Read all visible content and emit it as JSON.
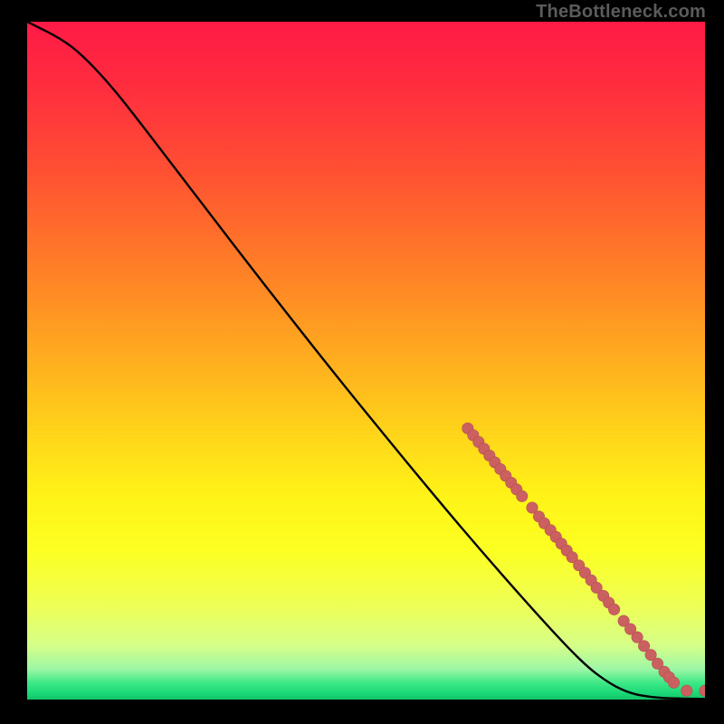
{
  "watermark": "TheBottleneck.com",
  "colors": {
    "gradient_stops": [
      {
        "offset": 0.0,
        "color": "#ff1a46"
      },
      {
        "offset": 0.1,
        "color": "#ff2e3e"
      },
      {
        "offset": 0.2,
        "color": "#ff4a34"
      },
      {
        "offset": 0.3,
        "color": "#ff6a2c"
      },
      {
        "offset": 0.4,
        "color": "#ff8b24"
      },
      {
        "offset": 0.5,
        "color": "#ffae1f"
      },
      {
        "offset": 0.6,
        "color": "#ffd21a"
      },
      {
        "offset": 0.7,
        "color": "#fff318"
      },
      {
        "offset": 0.78,
        "color": "#fcff22"
      },
      {
        "offset": 0.86,
        "color": "#eeff55"
      },
      {
        "offset": 0.92,
        "color": "#d6ff88"
      },
      {
        "offset": 0.955,
        "color": "#9df7a6"
      },
      {
        "offset": 0.975,
        "color": "#3fe887"
      },
      {
        "offset": 0.99,
        "color": "#1bd978"
      },
      {
        "offset": 1.0,
        "color": "#13c466"
      }
    ],
    "curve": "#000000",
    "marker_fill": "#cb6060",
    "marker_stroke": "#b45050"
  },
  "chart_data": {
    "type": "line",
    "title": "",
    "xlabel": "",
    "ylabel": "",
    "xlim": [
      0,
      100
    ],
    "ylim": [
      0,
      100
    ],
    "grid": false,
    "curve": [
      {
        "x": 0,
        "y": 100
      },
      {
        "x": 5,
        "y": 97.5
      },
      {
        "x": 8,
        "y": 95.2
      },
      {
        "x": 12,
        "y": 91.0
      },
      {
        "x": 16,
        "y": 86.0
      },
      {
        "x": 25,
        "y": 74.2
      },
      {
        "x": 35,
        "y": 61.2
      },
      {
        "x": 45,
        "y": 48.5
      },
      {
        "x": 55,
        "y": 36.2
      },
      {
        "x": 65,
        "y": 24.2
      },
      {
        "x": 75,
        "y": 12.8
      },
      {
        "x": 82,
        "y": 5.3
      },
      {
        "x": 86,
        "y": 2.3
      },
      {
        "x": 89,
        "y": 0.9
      },
      {
        "x": 92,
        "y": 0.35
      },
      {
        "x": 95,
        "y": 0.15
      },
      {
        "x": 100,
        "y": 0.1
      }
    ],
    "markers": [
      {
        "x": 65.0,
        "y": 40.0
      },
      {
        "x": 65.8,
        "y": 39.0
      },
      {
        "x": 66.6,
        "y": 38.0
      },
      {
        "x": 67.4,
        "y": 37.0
      },
      {
        "x": 68.2,
        "y": 36.0
      },
      {
        "x": 69.0,
        "y": 35.0
      },
      {
        "x": 69.8,
        "y": 34.0
      },
      {
        "x": 70.6,
        "y": 33.0
      },
      {
        "x": 71.4,
        "y": 32.0
      },
      {
        "x": 72.2,
        "y": 31.0
      },
      {
        "x": 73.0,
        "y": 30.0
      },
      {
        "x": 74.5,
        "y": 28.3
      },
      {
        "x": 75.5,
        "y": 27.0
      },
      {
        "x": 76.3,
        "y": 26.0
      },
      {
        "x": 77.2,
        "y": 25.0
      },
      {
        "x": 78.0,
        "y": 24.0
      },
      {
        "x": 78.8,
        "y": 23.0
      },
      {
        "x": 79.6,
        "y": 22.0
      },
      {
        "x": 80.4,
        "y": 21.0
      },
      {
        "x": 81.4,
        "y": 19.8
      },
      {
        "x": 82.3,
        "y": 18.7
      },
      {
        "x": 83.2,
        "y": 17.6
      },
      {
        "x": 84.0,
        "y": 16.5
      },
      {
        "x": 85.0,
        "y": 15.3
      },
      {
        "x": 85.8,
        "y": 14.3
      },
      {
        "x": 86.6,
        "y": 13.3
      },
      {
        "x": 88.0,
        "y": 11.6
      },
      {
        "x": 89.0,
        "y": 10.4
      },
      {
        "x": 90.0,
        "y": 9.2
      },
      {
        "x": 91.0,
        "y": 7.9
      },
      {
        "x": 92.0,
        "y": 6.6
      },
      {
        "x": 93.0,
        "y": 5.3
      },
      {
        "x": 94.0,
        "y": 4.1
      },
      {
        "x": 94.7,
        "y": 3.3
      },
      {
        "x": 95.4,
        "y": 2.5
      },
      {
        "x": 97.3,
        "y": 1.3
      },
      {
        "x": 100.0,
        "y": 1.3
      }
    ]
  }
}
